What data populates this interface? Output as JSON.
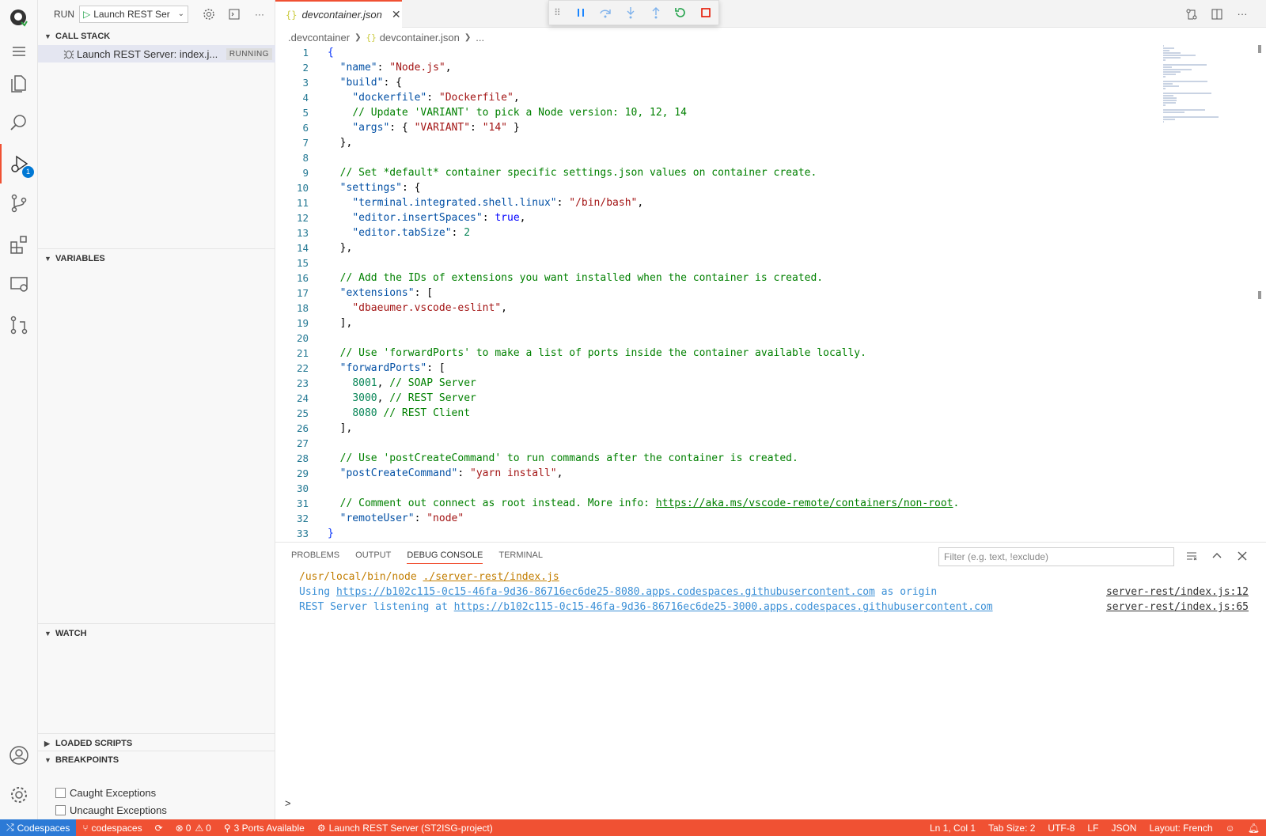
{
  "activity_bar": {
    "icons": [
      "github-icon",
      "menu-icon",
      "explorer-icon",
      "search-icon",
      "run-debug-icon",
      "source-control-icon",
      "extensions-icon",
      "remote-explorer-icon",
      "pull-requests-icon",
      "account-icon",
      "settings-icon"
    ],
    "debug_badge": "1"
  },
  "sidebar": {
    "run_label": "RUN",
    "config_name": "Launch REST Ser",
    "call_stack": {
      "title": "CALL STACK",
      "item_label": "Launch REST Server: index.j...",
      "item_status": "RUNNING"
    },
    "variables_title": "VARIABLES",
    "watch_title": "WATCH",
    "loaded_scripts_title": "LOADED SCRIPTS",
    "breakpoints": {
      "title": "BREAKPOINTS",
      "items": [
        "Caught Exceptions",
        "Uncaught Exceptions"
      ]
    }
  },
  "editor": {
    "tab_label": "devcontainer.json",
    "tab_icon": "{}",
    "breadcrumb": [
      ".devcontainer",
      "devcontainer.json",
      "..."
    ]
  },
  "code_lines": [
    [
      [
        "p",
        "{"
      ]
    ],
    [
      [
        "p",
        "  "
      ],
      [
        "k",
        "\"name\""
      ],
      [
        "p",
        ": "
      ],
      [
        "s",
        "\"Node.js\""
      ],
      [
        "p",
        ","
      ]
    ],
    [
      [
        "p",
        "  "
      ],
      [
        "k",
        "\"build\""
      ],
      [
        "p",
        ": {"
      ]
    ],
    [
      [
        "p",
        "    "
      ],
      [
        "k",
        "\"dockerfile\""
      ],
      [
        "p",
        ": "
      ],
      [
        "s",
        "\"Dockerfile\""
      ],
      [
        "p",
        ","
      ]
    ],
    [
      [
        "p",
        "    "
      ],
      [
        "c",
        "// Update 'VARIANT' to pick a Node version: 10, 12, 14"
      ]
    ],
    [
      [
        "p",
        "    "
      ],
      [
        "k",
        "\"args\""
      ],
      [
        "p",
        ": { "
      ],
      [
        "s",
        "\"VARIANT\""
      ],
      [
        "p",
        ": "
      ],
      [
        "s",
        "\"14\""
      ],
      [
        "p",
        " }"
      ]
    ],
    [
      [
        "p",
        "  },"
      ]
    ],
    [
      [
        "p",
        ""
      ]
    ],
    [
      [
        "p",
        "  "
      ],
      [
        "c",
        "// Set *default* container specific settings.json values on container create."
      ]
    ],
    [
      [
        "p",
        "  "
      ],
      [
        "k",
        "\"settings\""
      ],
      [
        "p",
        ": {"
      ]
    ],
    [
      [
        "p",
        "    "
      ],
      [
        "k",
        "\"terminal.integrated.shell.linux\""
      ],
      [
        "p",
        ": "
      ],
      [
        "s",
        "\"/bin/bash\""
      ],
      [
        "p",
        ","
      ]
    ],
    [
      [
        "p",
        "    "
      ],
      [
        "k",
        "\"editor.insertSpaces\""
      ],
      [
        "p",
        ": "
      ],
      [
        "b",
        "true"
      ],
      [
        "p",
        ","
      ]
    ],
    [
      [
        "p",
        "    "
      ],
      [
        "k",
        "\"editor.tabSize\""
      ],
      [
        "p",
        ": "
      ],
      [
        "n",
        "2"
      ]
    ],
    [
      [
        "p",
        "  },"
      ]
    ],
    [
      [
        "p",
        ""
      ]
    ],
    [
      [
        "p",
        "  "
      ],
      [
        "c",
        "// Add the IDs of extensions you want installed when the container is created."
      ]
    ],
    [
      [
        "p",
        "  "
      ],
      [
        "k",
        "\"extensions\""
      ],
      [
        "p",
        ": ["
      ]
    ],
    [
      [
        "p",
        "    "
      ],
      [
        "s",
        "\"dbaeumer.vscode-eslint\""
      ],
      [
        "p",
        ","
      ]
    ],
    [
      [
        "p",
        "  ],"
      ]
    ],
    [
      [
        "p",
        ""
      ]
    ],
    [
      [
        "p",
        "  "
      ],
      [
        "c",
        "// Use 'forwardPorts' to make a list of ports inside the container available locally."
      ]
    ],
    [
      [
        "p",
        "  "
      ],
      [
        "k",
        "\"forwardPorts\""
      ],
      [
        "p",
        ": ["
      ]
    ],
    [
      [
        "p",
        "    "
      ],
      [
        "n",
        "8001"
      ],
      [
        "p",
        ", "
      ],
      [
        "c",
        "// SOAP Server"
      ]
    ],
    [
      [
        "p",
        "    "
      ],
      [
        "n",
        "3000"
      ],
      [
        "p",
        ", "
      ],
      [
        "c",
        "// REST Server"
      ]
    ],
    [
      [
        "p",
        "    "
      ],
      [
        "n",
        "8080"
      ],
      [
        "p",
        " "
      ],
      [
        "c",
        "// REST Client"
      ]
    ],
    [
      [
        "p",
        "  ],"
      ]
    ],
    [
      [
        "p",
        ""
      ]
    ],
    [
      [
        "p",
        "  "
      ],
      [
        "c",
        "// Use 'postCreateCommand' to run commands after the container is created."
      ]
    ],
    [
      [
        "p",
        "  "
      ],
      [
        "k",
        "\"postCreateCommand\""
      ],
      [
        "p",
        ": "
      ],
      [
        "s",
        "\"yarn install\""
      ],
      [
        "p",
        ","
      ]
    ],
    [
      [
        "p",
        ""
      ]
    ],
    [
      [
        "p",
        "  "
      ],
      [
        "c",
        "// Comment out connect as root instead. More info: "
      ],
      [
        "u",
        "https://aka.ms/vscode-remote/containers/non-root"
      ],
      [
        "c",
        "."
      ]
    ],
    [
      [
        "p",
        "  "
      ],
      [
        "k",
        "\"remoteUser\""
      ],
      [
        "p",
        ": "
      ],
      [
        "s",
        "\"node\""
      ]
    ],
    [
      [
        "p",
        "}"
      ]
    ]
  ],
  "panel": {
    "tabs": [
      "PROBLEMS",
      "OUTPUT",
      "DEBUG CONSOLE",
      "TERMINAL"
    ],
    "active_tab": "DEBUG CONSOLE",
    "filter_placeholder": "Filter (e.g. text, !exclude)",
    "console": {
      "line1_cmd": "/usr/local/bin/node ",
      "line1_file": "./server-rest/index.js",
      "line2_pre": "Using ",
      "line2_url": "https://b102c115-0c15-46fa-9d36-86716ec6de25-8080.apps.codespaces.githubusercontent.com",
      "line2_post": " as origin",
      "line2_src": "server-rest/index.js:12",
      "line3_pre": "REST Server listening at ",
      "line3_url": "https://b102c115-0c15-46fa-9d36-86716ec6de25-3000.apps.codespaces.githubusercontent.com",
      "line3_src": "server-rest/index.js:65"
    },
    "prompt": ">"
  },
  "statusbar": {
    "remote": "Codespaces",
    "branch": "codespaces",
    "errors": "0",
    "warnings": "0",
    "ports": "3 Ports Available",
    "debug_session": "Launch REST Server (ST2ISG-project)",
    "position": "Ln 1, Col 1",
    "tab_size": "Tab Size: 2",
    "encoding": "UTF-8",
    "eol": "LF",
    "language": "JSON",
    "layout": "Layout: French"
  },
  "colors": {
    "accent": "#f05133",
    "remote": "#2c7ad6",
    "string": "#a31515",
    "key": "#0451a5",
    "comment": "#008000"
  }
}
